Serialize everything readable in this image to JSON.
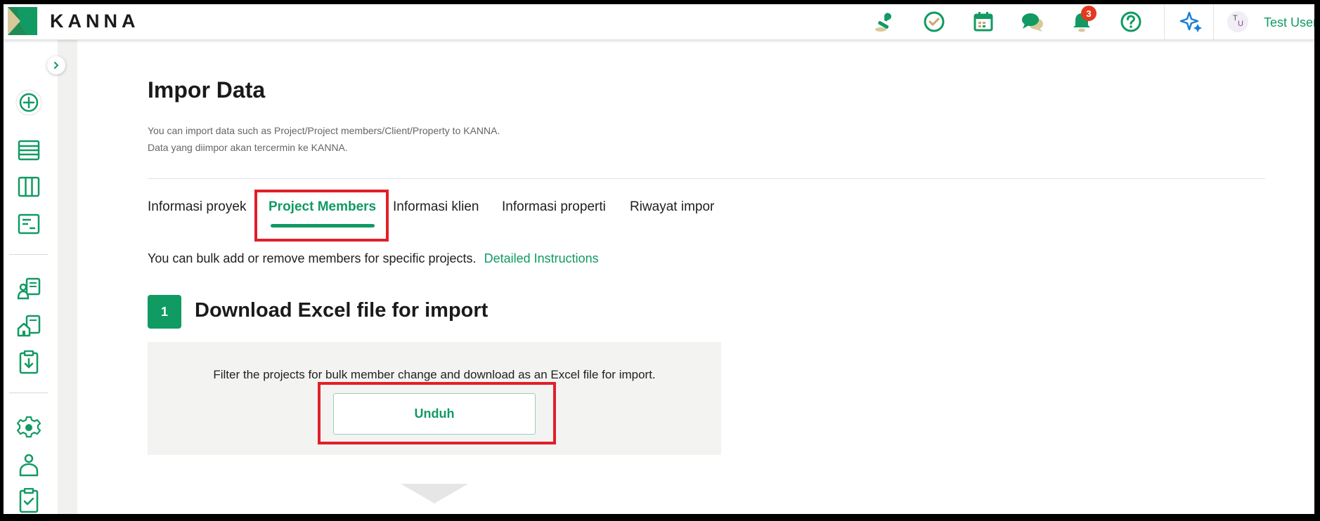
{
  "app": {
    "logo_text": "KANNA"
  },
  "header": {
    "notification_count": "3",
    "user": {
      "initial_top": "T",
      "initial_bottom": "U",
      "name": "Test User"
    }
  },
  "page": {
    "title": "Impor Data",
    "description_en": "You can import data such as Project/Project members/Client/Property to KANNA.",
    "description_id": "Data yang diimpor akan tercermin ke KANNA."
  },
  "tabs": [
    {
      "label": "Informasi proyek",
      "active": false
    },
    {
      "label": "Project Members",
      "active": true
    },
    {
      "label": "Informasi klien",
      "active": false
    },
    {
      "label": "Informasi properti",
      "active": false
    },
    {
      "label": "Riwayat impor",
      "active": false
    }
  ],
  "info": {
    "text": "You can bulk add or remove members for specific projects.",
    "link": "Detailed Instructions"
  },
  "step1": {
    "number": "1",
    "title": "Download Excel file for import",
    "panel_text": "Filter the projects for bulk member change and download as an Excel file for import.",
    "button_label": "Unduh"
  },
  "colors": {
    "brand_green": "#119a63",
    "highlight_red": "#e0202a",
    "badge_red": "#e5391f",
    "logo_tan": "#c8b88a"
  },
  "icons": {
    "header": [
      "stamp-icon",
      "check-circle-icon",
      "calendar-icon",
      "chat-icon",
      "bell-icon",
      "help-icon",
      "sparkle-icon"
    ],
    "sidebar": [
      "add-circle-icon",
      "list-icon",
      "board-icon",
      "report-icon",
      "client-icon",
      "property-icon",
      "import-icon",
      "settings-icon",
      "user-icon",
      "clipboard-check-icon"
    ]
  }
}
